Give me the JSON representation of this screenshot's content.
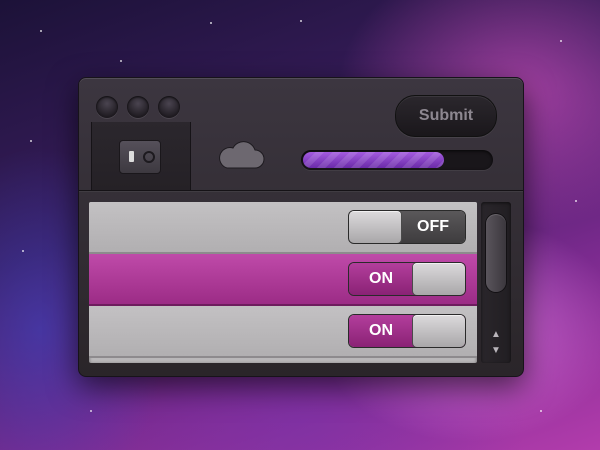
{
  "toolbar": {
    "submit_label": "Submit",
    "tab_icon": "switch-settings-icon",
    "cloud_icon": "cloud-icon"
  },
  "progress": {
    "value": 0.75
  },
  "list": {
    "rows": [
      {
        "state": "OFF",
        "selected": false
      },
      {
        "state": "ON",
        "selected": true
      },
      {
        "state": "ON",
        "selected": false
      }
    ]
  },
  "colors": {
    "accent": "#b33e9c",
    "progress": "#8a44c8",
    "window_dark": "#2a2529"
  }
}
